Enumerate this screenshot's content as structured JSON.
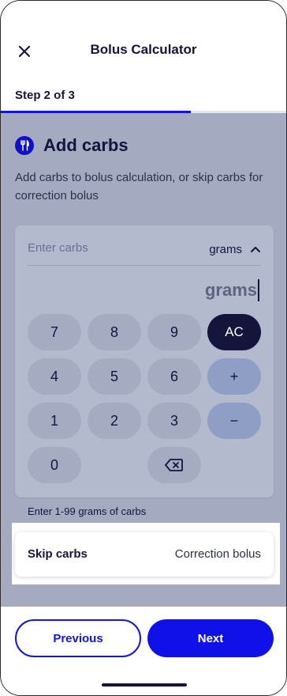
{
  "header": {
    "title": "Bolus Calculator",
    "close_icon": "close-icon",
    "step_label": "Step 2 of 3",
    "progress": {
      "current_step": 2,
      "total_steps": 3,
      "fraction": 0.667
    }
  },
  "section": {
    "icon": "fork-knife-icon",
    "title": "Add carbs",
    "description": "Add carbs to bolus calculation, or skip carbs for correction bolus"
  },
  "carbs_input": {
    "placeholder": "Enter carbs",
    "unit_selected": "grams",
    "unit_icon": "chevron-up-icon",
    "display_value": "grams",
    "hint": "Enter 1-99 grams of carbs"
  },
  "keypad": {
    "digits": [
      "7",
      "8",
      "9",
      "4",
      "5",
      "6",
      "1",
      "2",
      "3",
      "0"
    ],
    "clear_label": "AC",
    "plus_label": "+",
    "minus_label": "−",
    "backspace_icon": "backspace-icon"
  },
  "skip": {
    "label": "Skip carbs",
    "value": "Correction bolus"
  },
  "footer": {
    "previous_label": "Previous",
    "next_label": "Next"
  },
  "colors": {
    "primary": "#1515e0",
    "navy": "#14143c",
    "overlay": "#a4abc1"
  }
}
